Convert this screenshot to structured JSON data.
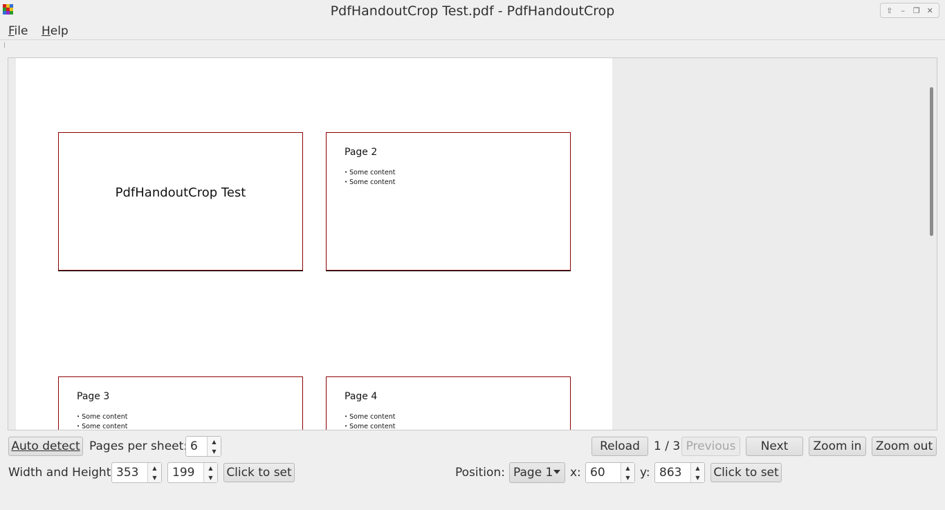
{
  "window": {
    "title": "PdfHandoutCrop Test.pdf - PdfHandoutCrop",
    "icon": "app-grid-icon",
    "controls": [
      "maximize-up-icon",
      "minimize-icon",
      "restore-icon",
      "close-icon"
    ]
  },
  "menu": {
    "file": "File",
    "help": "Help"
  },
  "viewer": {
    "slides": [
      {
        "title": "PdfHandoutCrop Test"
      },
      {
        "heading": "Page 2",
        "bullets": [
          "Some content",
          "Some content"
        ]
      },
      {
        "heading": "Page 3",
        "bullets": [
          "Some content",
          "Some content"
        ]
      },
      {
        "heading": "Page 4",
        "bullets": [
          "Some content",
          "Some content"
        ]
      }
    ]
  },
  "toolbar": {
    "auto_detect": "Auto detect",
    "pages_per_sheet_label": "Pages per sheet:",
    "pages_per_sheet_value": "6",
    "reload": "Reload",
    "page_indicator": "1 / 3",
    "previous": "Previous",
    "next": "Next",
    "zoom_in": "Zoom in",
    "zoom_out": "Zoom out",
    "wh_label": "Width and Height",
    "width_value": "353",
    "height_value": "199",
    "click_to_set_size": "Click to set",
    "position_label": "Position:",
    "position_page": "Page 1",
    "x_label": "x:",
    "x_value": "60",
    "y_label": "y:",
    "y_value": "863",
    "click_to_set_pos": "Click to set"
  },
  "colors": {
    "slide_border": "#8b0000",
    "background": "#efefef"
  }
}
